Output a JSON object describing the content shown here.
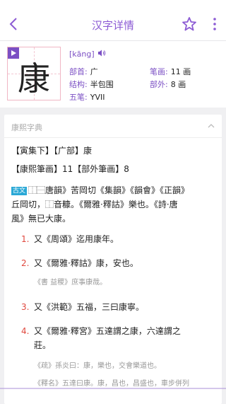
{
  "header": {
    "title": "汉字详情"
  },
  "hero": {
    "character": "康",
    "pinyin": "[kāng]",
    "fields": {
      "bushou_label": "部首:",
      "bushou_value": "广",
      "bihua_label": "笔画:",
      "bihua_value": "11 画",
      "jiegou_label": "结构:",
      "jiegou_value": "半包围",
      "buwai_label": "部外:",
      "buwai_value": "8 画",
      "wubi_label": "五笔:",
      "wubi_value": "YVII"
    }
  },
  "kangxi": {
    "section_title": "康熙字典",
    "line1": "【寅集下】【广部】康",
    "line2": "【康熙筆画】11【部外筆画】8",
    "guwen_tag": "古文",
    "para_line1": "⿰⿱唐韻》苦岡切《集韻》《韻會》《正韻》",
    "para_line2": "丘岡切，⿰音糠。《爾雅·釋詁》樂也。《詩·唐",
    "para_line3": "風》無已大康。",
    "definitions": [
      {
        "num": "1.",
        "text": "又《周頌》迄用康年。"
      },
      {
        "num": "2.",
        "text": "又《爾雅·釋詁》康，安也。",
        "quote": "《書 益稷》庶事康哉。"
      },
      {
        "num": "3.",
        "text": "又《洪範》五福，三曰康寧。"
      },
      {
        "num": "4.",
        "text_line1": "又《爾雅·釋宮》五達謂之康，六達謂之",
        "text_line2": "莊。",
        "quote": "《疏》孫炎曰：康，樂也，交會樂道也。",
        "quote2": "《釋名》五達曰康。康，昌也，昌盛也，車步併列"
      }
    ]
  }
}
